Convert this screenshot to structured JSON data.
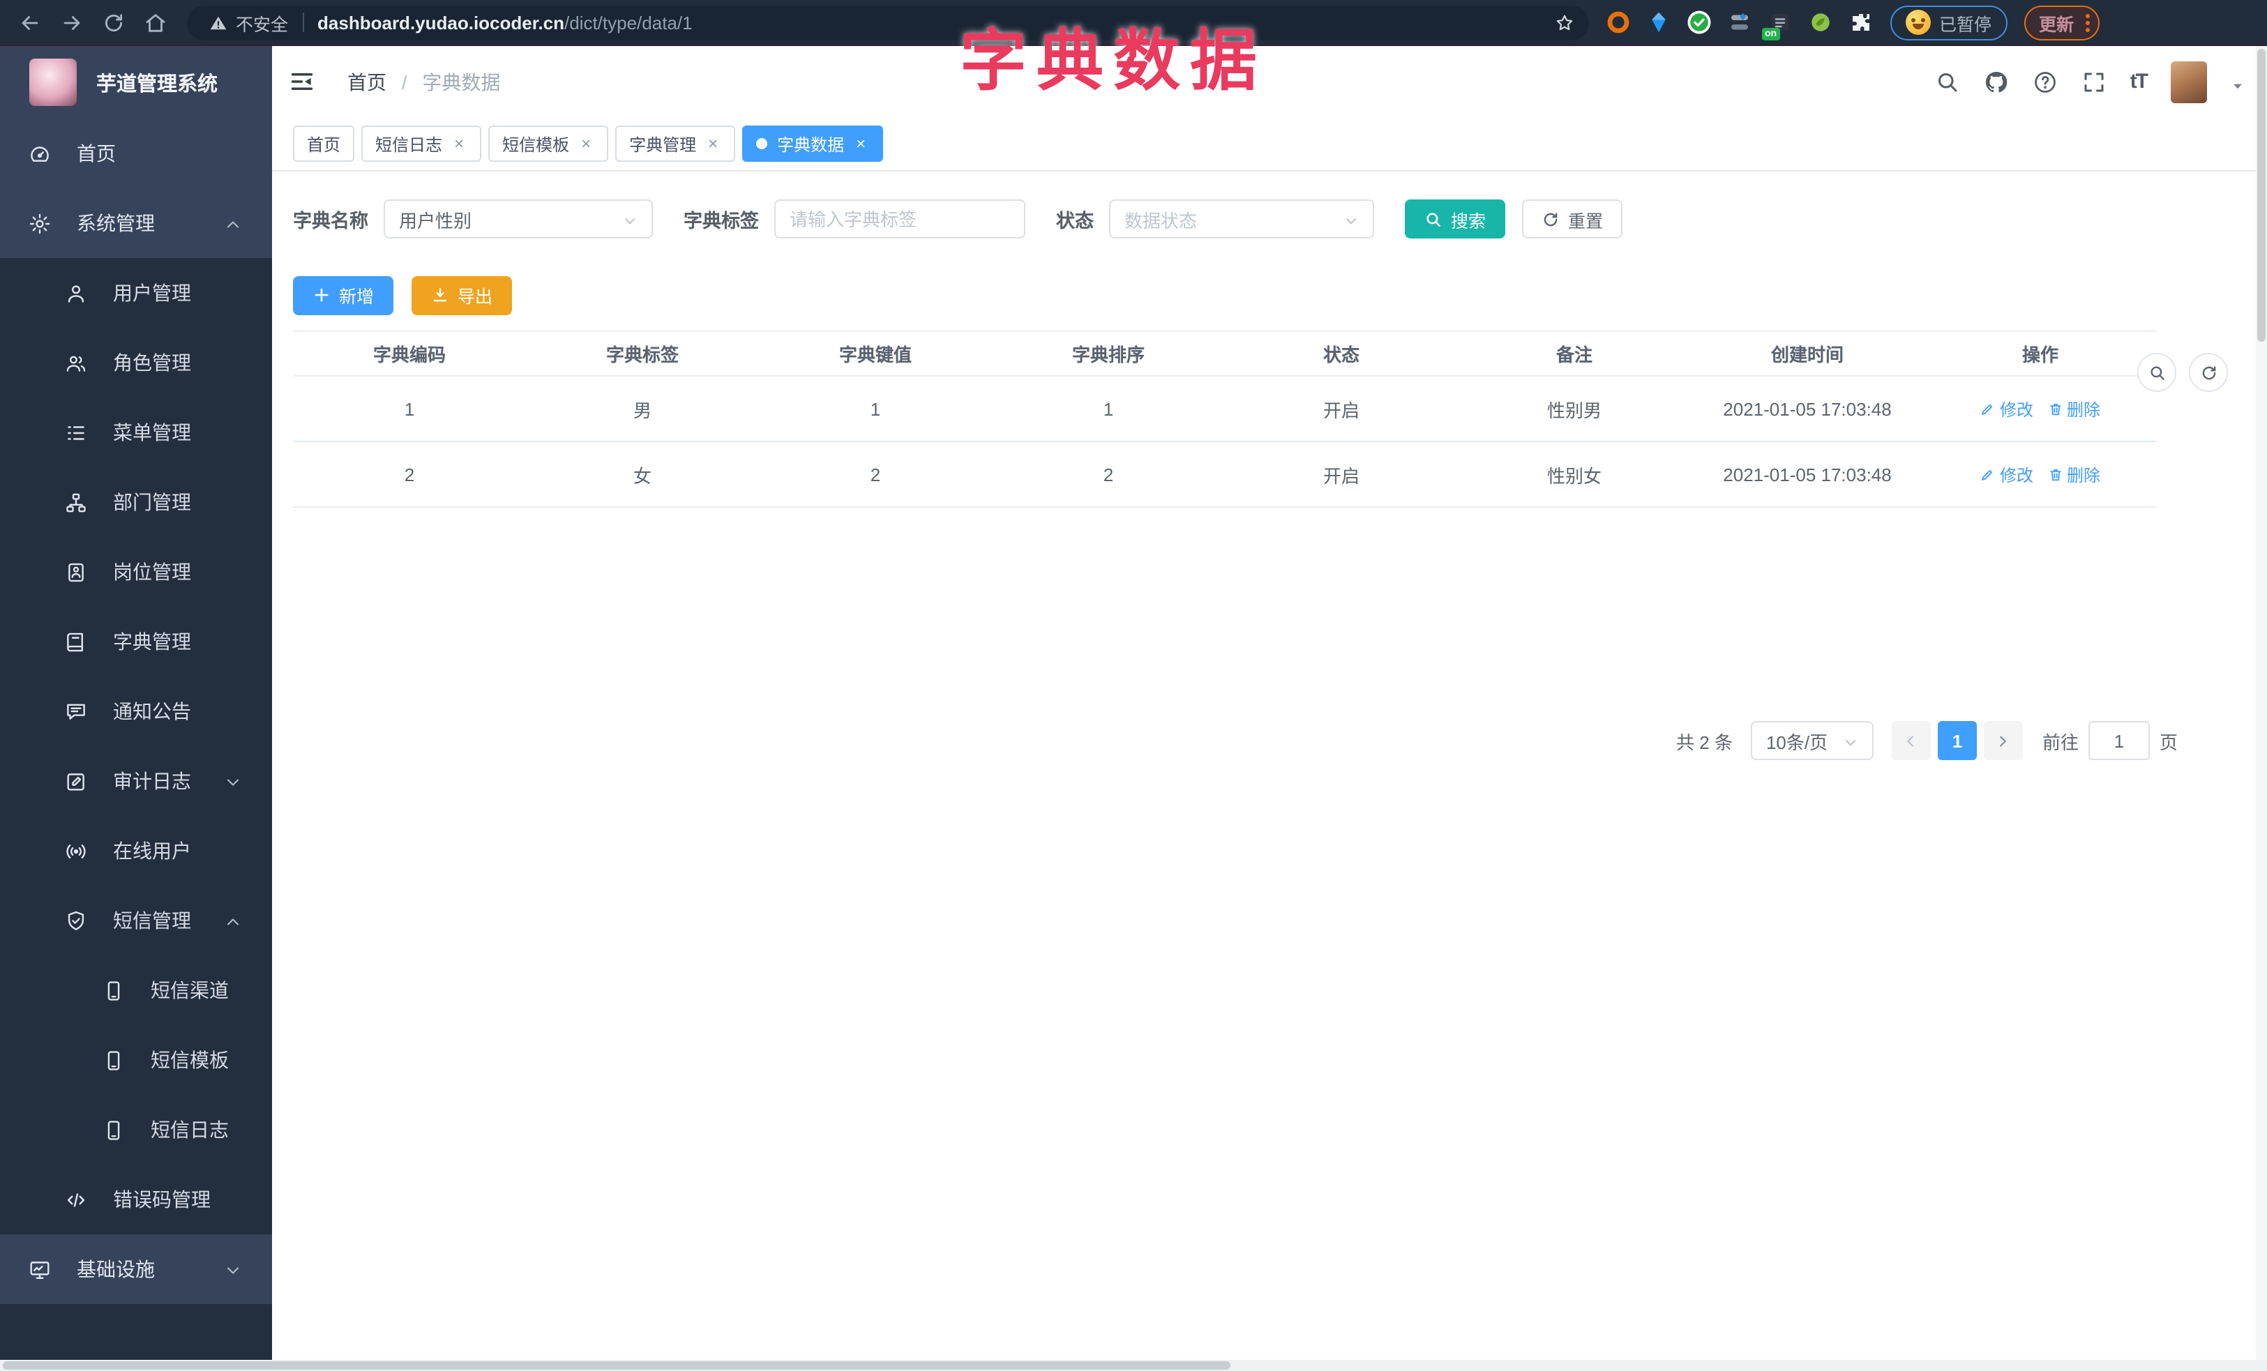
{
  "colors": {
    "accent": "#409eff",
    "teal": "#18b6a9",
    "warning": "#f0a31f",
    "overlay_red": "#ea3a5e"
  },
  "browser": {
    "security_label": "不安全",
    "url_domain": "dashboard.yudao.iocoder.cn",
    "url_path": "/dict/type/data/1",
    "paused_label": "已暂停",
    "update_label": "更新",
    "ext_on_badge": "on",
    "extensions": [
      {
        "name": "ext-orange-ring-icon"
      },
      {
        "name": "ext-blue-gem-icon"
      },
      {
        "name": "ext-green-check-icon"
      },
      {
        "name": "ext-toggle-icon"
      },
      {
        "name": "ext-dark-on-icon",
        "badge": "on"
      },
      {
        "name": "ext-green-leaf-icon"
      },
      {
        "name": "ext-puzzle-icon"
      }
    ]
  },
  "overlay": {
    "title": "字典数据"
  },
  "sidebar": {
    "app_title": "芋道管理系统",
    "items": [
      {
        "name": "home",
        "label": "首页",
        "icon": "dashboard-icon",
        "level": 0
      },
      {
        "name": "system-management",
        "label": "系统管理",
        "icon": "gear-icon",
        "level": 0,
        "chevron": "up"
      },
      {
        "name": "user-management",
        "label": "用户管理",
        "icon": "user-icon",
        "level": 1
      },
      {
        "name": "role-management",
        "label": "角色管理",
        "icon": "users-icon",
        "level": 1
      },
      {
        "name": "menu-management",
        "label": "菜单管理",
        "icon": "menu-list-icon",
        "level": 1
      },
      {
        "name": "department-management",
        "label": "部门管理",
        "icon": "org-tree-icon",
        "level": 1
      },
      {
        "name": "post-management",
        "label": "岗位管理",
        "icon": "badge-icon",
        "level": 1
      },
      {
        "name": "dict-management",
        "label": "字典管理",
        "icon": "dictionary-icon",
        "level": 1
      },
      {
        "name": "notice-announcement",
        "label": "通知公告",
        "icon": "announcement-icon",
        "level": 1
      },
      {
        "name": "audit-log",
        "label": "审计日志",
        "icon": "audit-log-icon",
        "level": 1,
        "chevron": "down"
      },
      {
        "name": "online-users",
        "label": "在线用户",
        "icon": "online-users-icon",
        "level": 1
      },
      {
        "name": "sms-management",
        "label": "短信管理",
        "icon": "shield-check-icon",
        "level": 1,
        "chevron": "up"
      },
      {
        "name": "sms-channel",
        "label": "短信渠道",
        "icon": "phone-icon",
        "level": 2
      },
      {
        "name": "sms-template",
        "label": "短信模板",
        "icon": "phone-icon",
        "level": 2
      },
      {
        "name": "sms-log",
        "label": "短信日志",
        "icon": "phone-icon",
        "level": 2
      },
      {
        "name": "error-code-management",
        "label": "错误码管理",
        "icon": "code-icon",
        "level": 1
      },
      {
        "name": "infrastructure",
        "label": "基础设施",
        "icon": "infrastructure-icon",
        "level": 0,
        "chevron": "down"
      }
    ]
  },
  "header": {
    "breadcrumb_home": "首页",
    "breadcrumb_sep": "/",
    "breadcrumb_current": "字典数据"
  },
  "tabs": [
    {
      "name": "home",
      "label": "首页",
      "closable": false,
      "active": false
    },
    {
      "name": "sms-log",
      "label": "短信日志",
      "closable": true,
      "active": false
    },
    {
      "name": "sms-template",
      "label": "短信模板",
      "closable": true,
      "active": false
    },
    {
      "name": "dict-management",
      "label": "字典管理",
      "closable": true,
      "active": false
    },
    {
      "name": "dict-data",
      "label": "字典数据",
      "closable": true,
      "active": true
    }
  ],
  "filters": {
    "name_label": "字典名称",
    "name_value": "用户性别",
    "label_label": "字典标签",
    "label_placeholder": "请输入字典标签",
    "status_label": "状态",
    "status_placeholder": "数据状态",
    "search_label": "搜索",
    "reset_label": "重置"
  },
  "toolbar": {
    "add_label": "新增",
    "export_label": "导出"
  },
  "table": {
    "headers": [
      "字典编码",
      "字典标签",
      "字典键值",
      "字典排序",
      "状态",
      "备注",
      "创建时间",
      "操作"
    ],
    "rows": [
      {
        "code": "1",
        "label": "男",
        "value": "1",
        "sort": "1",
        "status": "开启",
        "remark": "性别男",
        "created": "2021-01-05 17:03:48"
      },
      {
        "code": "2",
        "label": "女",
        "value": "2",
        "sort": "2",
        "status": "开启",
        "remark": "性别女",
        "created": "2021-01-05 17:03:48"
      }
    ],
    "edit_label": "修改",
    "delete_label": "删除"
  },
  "pagination": {
    "total_label": "共 2 条",
    "page_size_value": "10条/页",
    "current_page": "1",
    "goto_label": "前往",
    "goto_value": "1",
    "page_unit_label": "页"
  }
}
